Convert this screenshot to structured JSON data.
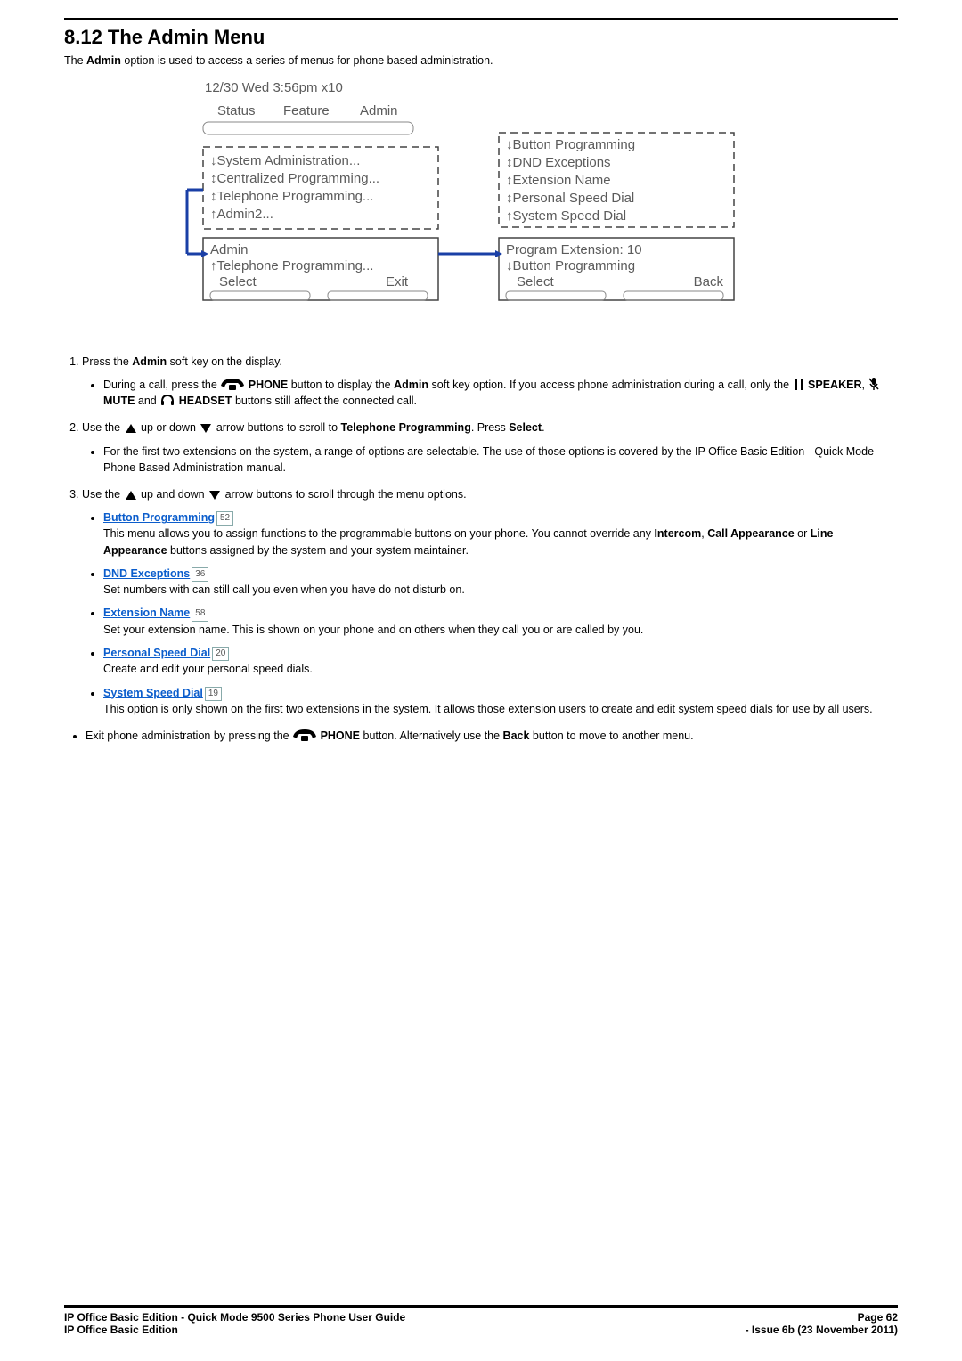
{
  "heading": "8.12 The Admin Menu",
  "intro_pre": "The ",
  "intro_strong": "Admin",
  "intro_post": " option is used to access a series of menus for phone based administration.",
  "diagram": {
    "datetime": "12/30 Wed        3:56pm     x10",
    "tabs": [
      "Status",
      "Feature",
      "Admin"
    ],
    "menu1": [
      "↓System Administration...",
      "↕Centralized Programming...",
      "↕Telephone Programming...",
      "↑Admin2..."
    ],
    "panel1_title": "Admin",
    "panel1_line2": "↑Telephone Programming...",
    "panel1_left": "Select",
    "panel1_right": "Exit",
    "menu2": [
      "↓Button Programming",
      "↕DND Exceptions",
      "↕Extension Name",
      "↕Personal Speed Dial",
      "↑System Speed Dial"
    ],
    "panel2_title": "Program Extension: 10",
    "panel2_line2": "↓Button Programming",
    "panel2_left": "Select",
    "panel2_right": "Back"
  },
  "step1": {
    "pre": "Press the ",
    "strong": "Admin",
    "post": " soft key on the display.",
    "bullet_pre": "During a call, press the ",
    "phone": "PHONE",
    "bullet_mid1": " button to display the ",
    "admin": "Admin",
    "bullet_mid2": " soft key option. If you access phone administration during a call, only the ",
    "speaker": "SPEAKER",
    "comma": ", ",
    "mute": "MUTE",
    "and": " and ",
    "headset": "HEADSET",
    "bullet_tail": " buttons still affect the connected call."
  },
  "step2": {
    "pre": "Use the ",
    "mid1": " up or down ",
    "mid2": " arrow buttons to scroll to ",
    "target": "Telephone Programming",
    "post1": ". Press ",
    "select": "Select",
    "post2": ".",
    "bullet": "For the first two extensions on the system, a range of options are selectable. The use of those options is covered by the IP Office Basic Edition - Quick Mode Phone Based Administration manual."
  },
  "step3": {
    "pre": "Use the ",
    "mid1": " up and down ",
    "mid2": " arrow buttons to scroll through the menu options.",
    "items": [
      {
        "link": "Button Programming",
        "ref": "52",
        "desc_pre": "This menu allows you to assign functions to the programmable buttons on your phone. You cannot override any ",
        "desc_b1": "Intercom",
        "desc_s1": ", ",
        "desc_b2": "Call Appearance",
        "desc_s2": " or ",
        "desc_b3": "Line Appearance",
        "desc_post": " buttons assigned by the system and your system maintainer."
      },
      {
        "link": "DND Exceptions",
        "ref": "36",
        "desc": "Set numbers with can still call you even when you have do not disturb on."
      },
      {
        "link": "Extension Name",
        "ref": "58",
        "desc": "Set your extension name. This is shown on your phone and on others when they call you or are called by you."
      },
      {
        "link": "Personal Speed Dial",
        "ref": "20",
        "desc": "Create and edit your personal speed dials."
      },
      {
        "link": "System Speed Dial",
        "ref": "19",
        "desc": "This option is only shown on the first two extensions in the system. It allows those extension users to create and edit system speed dials for use by all users."
      }
    ]
  },
  "exit": {
    "pre": "Exit phone administration by pressing the ",
    "phone": "PHONE",
    "mid": " button. Alternatively use the ",
    "back": "Back",
    "post": " button to move to another menu."
  },
  "footer": {
    "left1": "IP Office Basic Edition - Quick Mode 9500 Series Phone User Guide",
    "right1": "Page 62",
    "left2": "IP Office Basic Edition",
    "right2": "- Issue 6b (23 November 2011)"
  }
}
